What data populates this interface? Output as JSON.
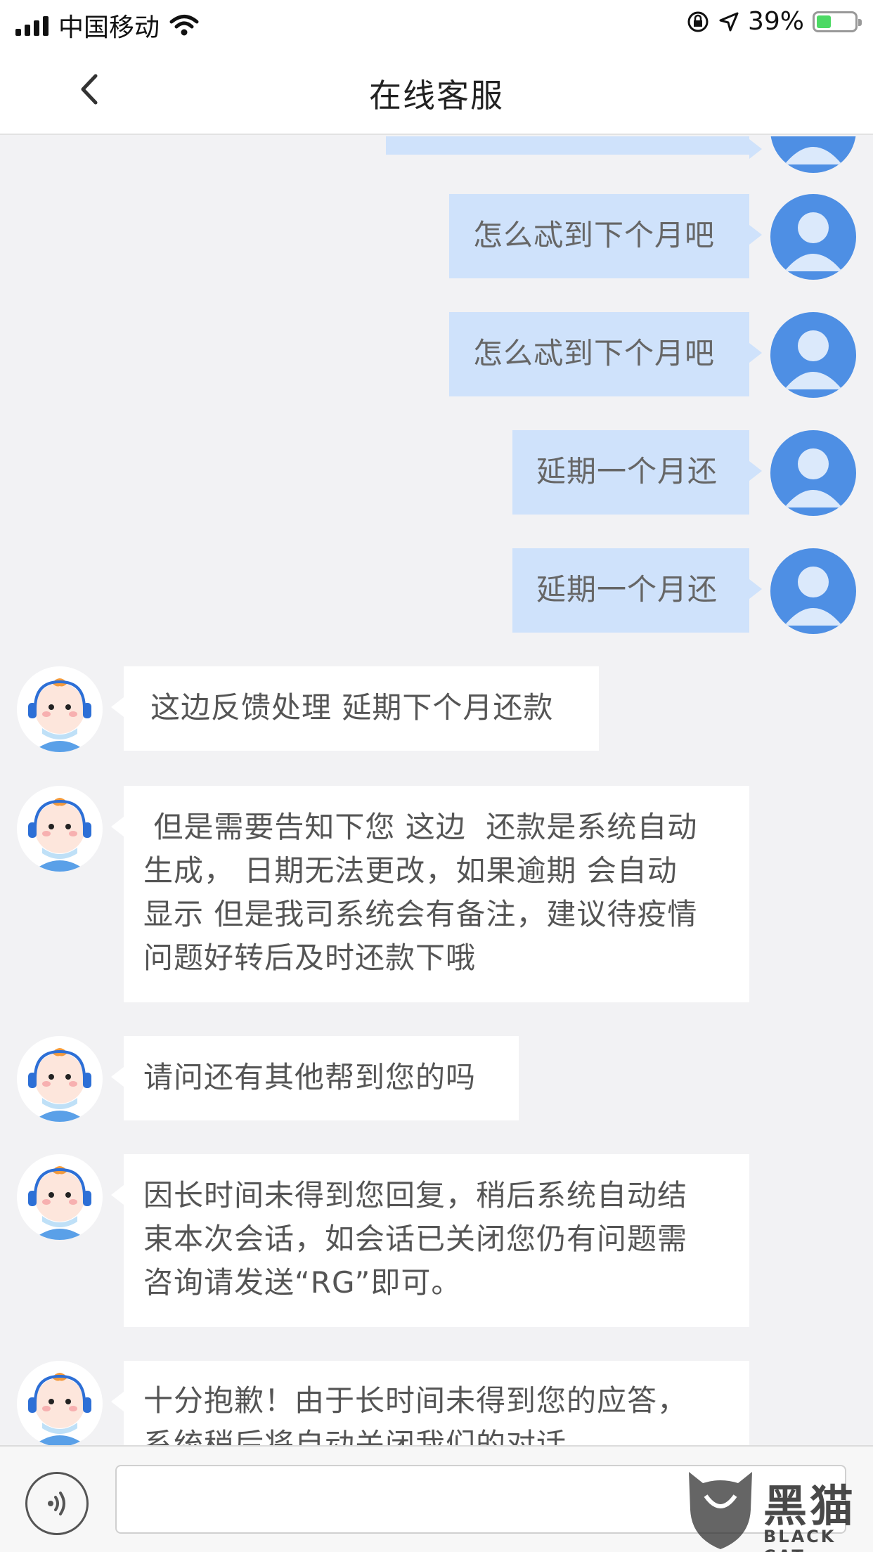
{
  "status_bar": {
    "carrier": "中国移动",
    "battery_text": "39%",
    "battery_level": 0.39,
    "icons": [
      "signal-icon",
      "wifi-icon",
      "orientation-lock-icon",
      "location-icon",
      "battery-icon"
    ]
  },
  "nav": {
    "title": "在线客服",
    "back_icon": "chevron-left-icon"
  },
  "messages": [
    {
      "from": "user",
      "text": "怎么忒到下个月吧"
    },
    {
      "from": "user",
      "text": "怎么忒到下个月吧"
    },
    {
      "from": "user",
      "text": "延期一个月还"
    },
    {
      "from": "user",
      "text": "延期一个月还"
    },
    {
      "from": "bot",
      "text": "这边反馈处理 延期下个月还款"
    },
    {
      "from": "bot",
      "lines": [
        " 但是需要告知下您 这边  还款是系统自动",
        "生成， 日期无法更改，如果逾期 会自动",
        "显示 但是我司系统会有备注，建议待疫情",
        "问题好转后及时还款下哦"
      ]
    },
    {
      "from": "bot",
      "text": "请问还有其他帮到您的吗"
    },
    {
      "from": "bot",
      "lines": [
        "因长时间未得到您回复，稍后系统自动结",
        "束本次会话，如会话已关闭您仍有问题需",
        "咨询请发送“RG”即可。"
      ]
    },
    {
      "from": "bot",
      "lines": [
        "十分抱歉！由于长时间未得到您的应答，",
        "系统稍后将自动关闭我们的对话。"
      ]
    }
  ],
  "input_bar": {
    "voice_icon": "voice-icon",
    "input_value": ""
  },
  "watermark": {
    "text": "黑猫",
    "subtext": "BLACK CAT"
  },
  "colors": {
    "user_bubble": "#cfe2fb",
    "bot_bubble": "#ffffff",
    "user_avatar": "#4e8fe4",
    "background": "#f2f2f4"
  }
}
